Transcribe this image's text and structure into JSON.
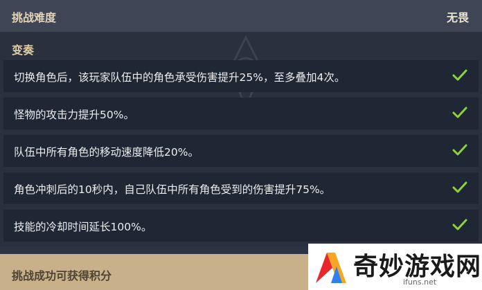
{
  "header": {
    "title": "挑战难度",
    "value": "无畏"
  },
  "variations": {
    "title": "变奏",
    "items": [
      {
        "text": "切换角色后，该玩家队伍中的角色承受伤害提升25%，至多叠加4次。",
        "icon": "check-icon"
      },
      {
        "text": "怪物的攻击力提升50%。",
        "icon": "check-icon"
      },
      {
        "text": "队伍中所有角色的移动速度降低20%。",
        "icon": "check-icon"
      },
      {
        "text": "角色冲刺后的10秒内，自己队伍中所有角色受到的伤害提升75%。",
        "icon": "check-icon"
      },
      {
        "text": "技能的冷却时间延长100%。",
        "icon": "check-icon"
      }
    ]
  },
  "footer": {
    "label": "挑战成功可获得积分"
  },
  "watermark": {
    "brand": "奇妙游戏网",
    "url": "ifuns.net"
  },
  "colors": {
    "background": "#2b3344",
    "header": "#3e4656",
    "row": "#1f2634",
    "check": "#8ed436",
    "footer": "#c7b08a"
  }
}
